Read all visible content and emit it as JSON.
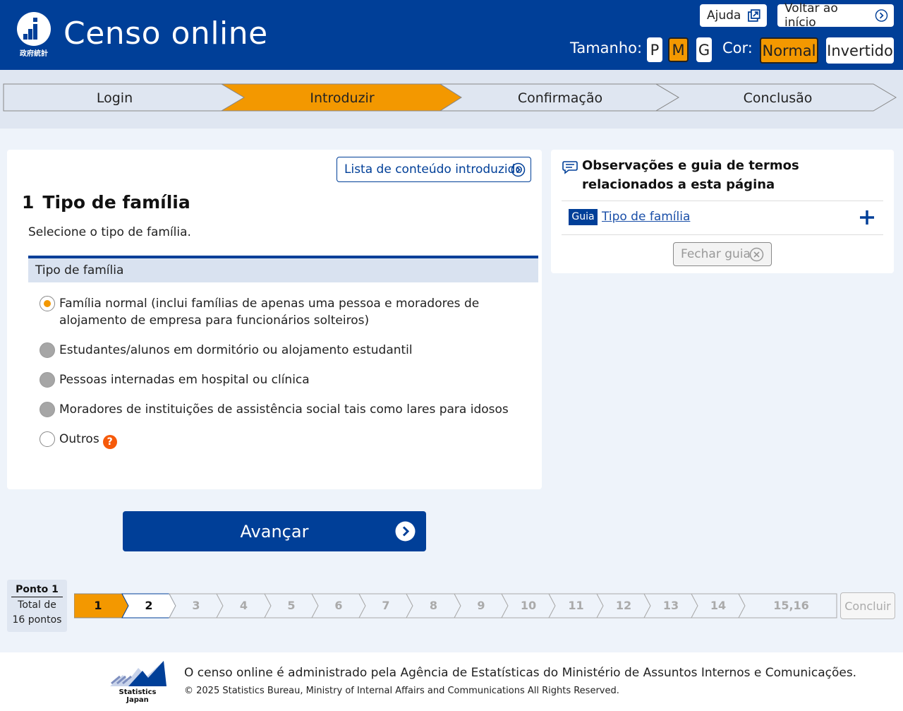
{
  "header": {
    "logo_text": "政府統計",
    "title": "Censo online",
    "help_label": "Ajuda",
    "home_label": "Voltar ao início",
    "size_label": "Tamanho:",
    "sizes": [
      {
        "label": "P",
        "active": false
      },
      {
        "label": "M",
        "active": true
      },
      {
        "label": "G",
        "active": false
      }
    ],
    "color_label": "Cor:",
    "colors": [
      {
        "label": "Normal",
        "active": true
      },
      {
        "label": "Invertido",
        "active": false
      }
    ]
  },
  "steps": [
    {
      "label": "Login",
      "state": "done"
    },
    {
      "label": "Introduzir",
      "state": "current"
    },
    {
      "label": "Confirmação",
      "state": "todo"
    },
    {
      "label": "Conclusão",
      "state": "todo"
    }
  ],
  "question": {
    "list_button": "Lista de conteúdo introduzido",
    "number": "1",
    "title": "Tipo de família",
    "description": "Selecione o tipo de família.",
    "group_label": "Tipo de família",
    "options": [
      {
        "label": "Família normal (inclui famílias de apenas uma pessoa e moradores de alojamento de empresa para funcionários solteiros)",
        "state": "selected"
      },
      {
        "label": "Estudantes/alunos em dormitório ou alojamento estudantil",
        "state": "disabled"
      },
      {
        "label": "Pessoas internadas em hospital ou clínica",
        "state": "disabled"
      },
      {
        "label": "Moradores de instituições de assistência social tais como lares para idosos",
        "state": "disabled"
      },
      {
        "label": "Outros",
        "state": "unselected",
        "help": "?"
      }
    ]
  },
  "guide": {
    "title": "Observações e guia de termos relacionados a esta página",
    "tag": "Guia",
    "link": "Tipo de família",
    "close_label": "Fechar guia"
  },
  "next_label": "Avançar",
  "progress": {
    "current_label": "Ponto 1",
    "total_label_1": "Total de",
    "total_label_2": "16 pontos",
    "points": [
      "1",
      "2",
      "3",
      "4",
      "5",
      "6",
      "7",
      "8",
      "9",
      "10",
      "11",
      "12",
      "13",
      "14",
      "15,16"
    ],
    "current_index": 0,
    "conclude_label": "Concluir"
  },
  "footer": {
    "logo_caption": "Statistics Japan",
    "main_text": "O censo online é administrado pela Agência de Estatísticas do Ministério de Assuntos Internos e Comunicações.",
    "copyright": "© 2025 Statistics Bureau, Ministry of Internal Affairs and Communications All Rights Reserved."
  },
  "colors": {
    "primary": "#003f98",
    "accent": "#f39800",
    "help_icon": "#f65a0a"
  }
}
